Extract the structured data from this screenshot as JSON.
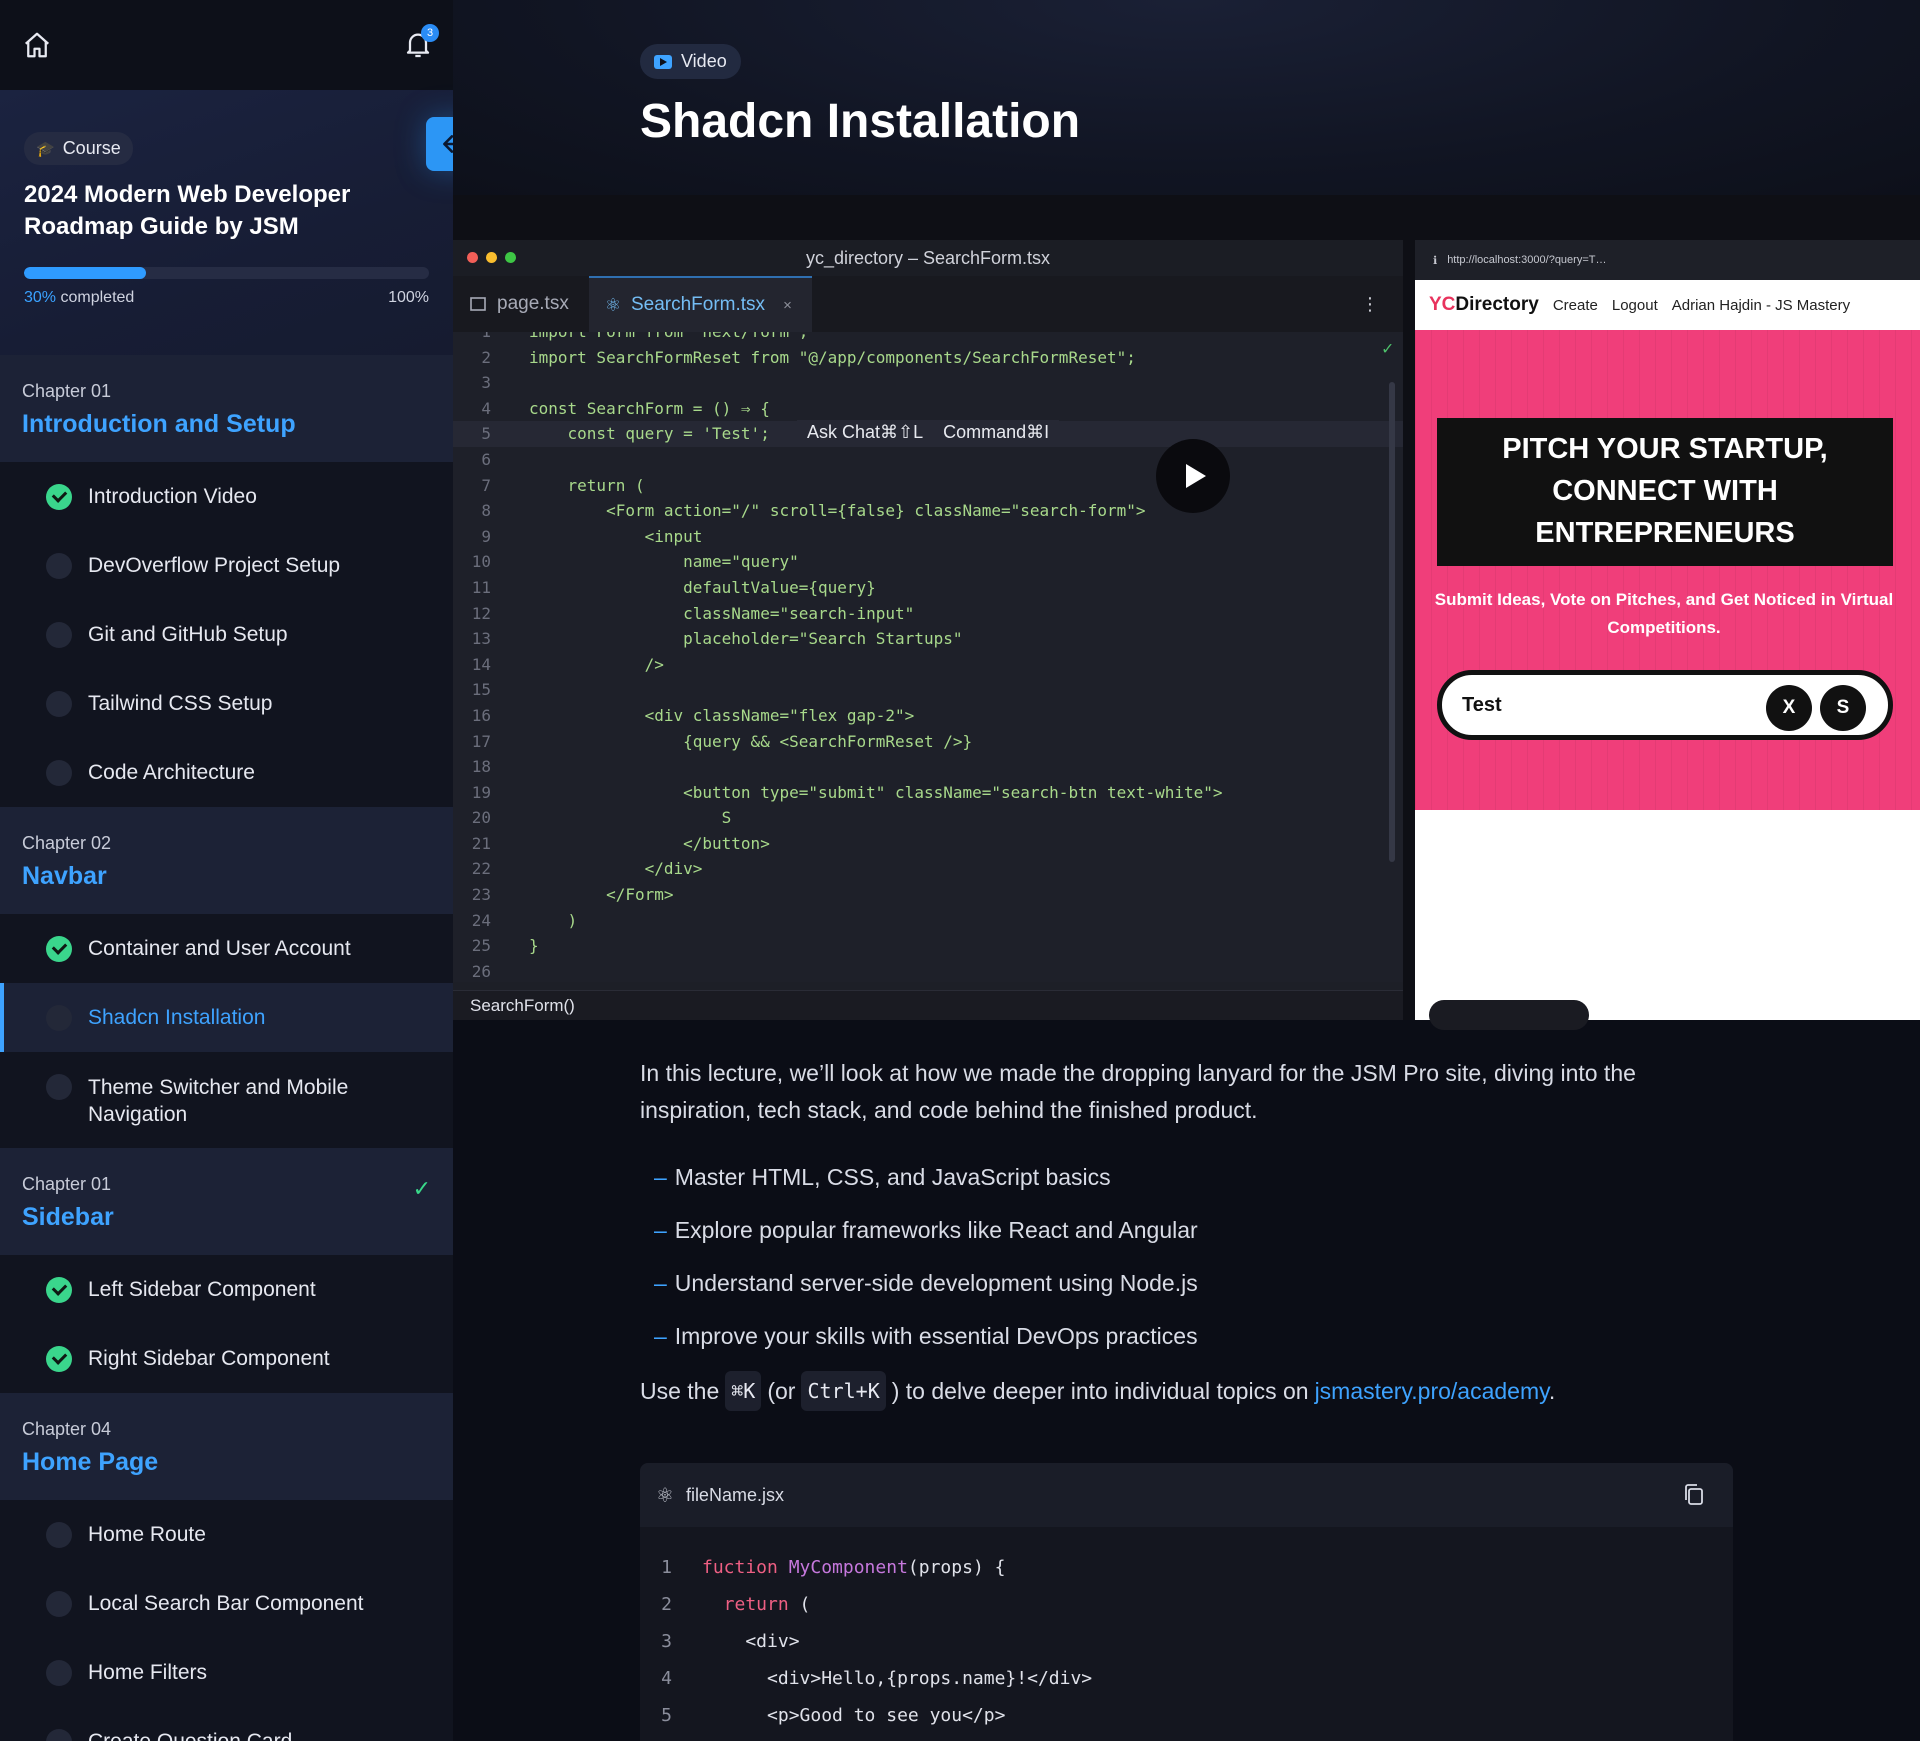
{
  "topbar": {
    "notification_count": "3"
  },
  "course": {
    "badge": "Course",
    "title": "2024 Modern Web Developer Roadmap Guide by JSM",
    "progress_pct": 30,
    "progress_label_pct": "30%",
    "progress_label_text": "completed",
    "progress_max": "100%"
  },
  "chapters": [
    {
      "number": "Chapter 01",
      "name": "Introduction and Setup",
      "completed": false,
      "lessons": [
        {
          "title": "Introduction Video",
          "done": true
        },
        {
          "title": "DevOverflow Project Setup",
          "done": false
        },
        {
          "title": "Git and GitHub Setup",
          "done": false
        },
        {
          "title": "Tailwind CSS Setup",
          "done": false
        },
        {
          "title": "Code Architecture",
          "done": false
        }
      ]
    },
    {
      "number": "Chapter 02",
      "name": "Navbar",
      "completed": false,
      "lessons": [
        {
          "title": "Container and User Account",
          "done": true
        },
        {
          "title": "Shadcn Installation",
          "done": false,
          "active": true
        },
        {
          "title": "Theme Switcher and Mobile Navigation",
          "done": false
        }
      ]
    },
    {
      "number": "Chapter 01",
      "name": "Sidebar",
      "completed": true,
      "lessons": [
        {
          "title": "Left Sidebar Component",
          "done": true
        },
        {
          "title": "Right Sidebar Component",
          "done": true
        }
      ]
    },
    {
      "number": "Chapter 04",
      "name": "Home Page",
      "completed": false,
      "lessons": [
        {
          "title": "Home Route",
          "done": false
        },
        {
          "title": "Local Search Bar Component",
          "done": false
        },
        {
          "title": "Home Filters",
          "done": false
        },
        {
          "title": "Create Question Card",
          "done": false
        }
      ]
    }
  ],
  "lesson": {
    "type_badge": "Video",
    "title": "Shadcn Installation"
  },
  "video": {
    "editor_title": "yc_directory – SearchForm.tsx",
    "tabs": [
      {
        "label": "page.tsx"
      },
      {
        "label": "SearchForm.tsx",
        "active": true
      }
    ],
    "tab_close": "×",
    "status": "SearchForm()",
    "popup_ask": "Ask Chat⌘⇧L",
    "popup_cmd": "Command⌘I",
    "code_lines": [
      {
        "n": "1",
        "t": "import Form from \"next/form\";"
      },
      {
        "n": "2",
        "t": "import SearchFormReset from \"@/app/components/SearchFormReset\";"
      },
      {
        "n": "3",
        "t": ""
      },
      {
        "n": "4",
        "t": "const SearchForm = () ⇒ {"
      },
      {
        "n": "5",
        "t": "    const query = 'Test';"
      },
      {
        "n": "6",
        "t": ""
      },
      {
        "n": "7",
        "t": "    return ("
      },
      {
        "n": "8",
        "t": "        <Form action=\"/\" scroll={false} className=\"search-form\">"
      },
      {
        "n": "9",
        "t": "            <input"
      },
      {
        "n": "10",
        "t": "                name=\"query\""
      },
      {
        "n": "11",
        "t": "                defaultValue={query}"
      },
      {
        "n": "12",
        "t": "                className=\"search-input\""
      },
      {
        "n": "13",
        "t": "                placeholder=\"Search Startups\""
      },
      {
        "n": "14",
        "t": "            />"
      },
      {
        "n": "15",
        "t": ""
      },
      {
        "n": "16",
        "t": "            <div className=\"flex gap-2\">"
      },
      {
        "n": "17",
        "t": "                {query && <SearchFormReset />}"
      },
      {
        "n": "18",
        "t": ""
      },
      {
        "n": "19",
        "t": "                <button type=\"submit\" className=\"search-btn text-white\">"
      },
      {
        "n": "20",
        "t": "                    S"
      },
      {
        "n": "21",
        "t": "                </button>"
      },
      {
        "n": "22",
        "t": "            </div>"
      },
      {
        "n": "23",
        "t": "        </Form>"
      },
      {
        "n": "24",
        "t": "    )"
      },
      {
        "n": "25",
        "t": "}"
      },
      {
        "n": "26",
        "t": ""
      }
    ],
    "browser": {
      "url": "http://localhost:3000/?query=T…",
      "logo_yc": "YC",
      "logo_rest": "Directory",
      "nav": [
        "Create",
        "Logout",
        "Adrian Hajdin - JS Mastery"
      ],
      "headline": "PITCH YOUR STARTUP, CONNECT WITH ENTREPRENEURS",
      "subhead": "Submit Ideas, Vote on Pitches, and Get Noticed in Virtual Competitions.",
      "search_value": "Test",
      "btn_x": "X",
      "btn_s": "S"
    }
  },
  "content": {
    "intro": "In this lecture, we’ll look at how we made the dropping lanyard for the JSM Pro site, diving into the inspiration, tech stack, and code behind the finished product.",
    "bullets": [
      "Master HTML, CSS, and JavaScript basics",
      "Explore popular frameworks like React and Angular",
      "Understand server-side development using Node.js",
      "Improve your skills with essential DevOps practices"
    ],
    "use_prefix": "Use the",
    "kbd_mac": "⌘K",
    "use_mid": "(or",
    "kbd_win": "Ctrl+K",
    "use_suffix": ") to delve deeper into individual topics on",
    "link": "jsmastery.pro/academy",
    "period": "."
  },
  "codeblock": {
    "filename": "fileName.jsx",
    "lines": [
      {
        "n": "1",
        "kw": "fuction",
        "fn": "MyComponent",
        "rest": "(props) {"
      },
      {
        "n": "2",
        "kw": "  return",
        "rest": " ("
      },
      {
        "n": "3",
        "rest": "    <div>"
      },
      {
        "n": "4",
        "rest": "      <div>Hello,{props.name}!</div>"
      },
      {
        "n": "5",
        "rest": "      <p>Good to see you</p>"
      }
    ]
  }
}
